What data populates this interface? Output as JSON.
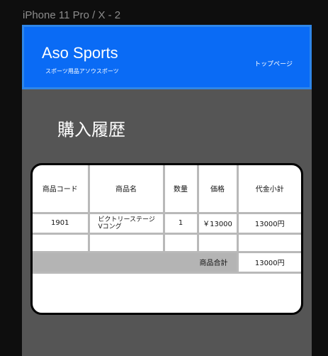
{
  "artboard": {
    "title": "iPhone 11 Pro / X - 2"
  },
  "header": {
    "brand": "Aso Sports",
    "tagline": "スポーツ用品アソウスポーツ",
    "top_link": "トップページ"
  },
  "page": {
    "title": "購入履歴"
  },
  "table": {
    "headers": {
      "code": "商品コード",
      "name": "商品名",
      "qty": "数量",
      "price": "価格",
      "subtotal": "代金小計"
    },
    "rows": [
      {
        "code": "1901",
        "name": "ビクトリーステージ\nVコング",
        "qty": "1",
        "price": "￥13000",
        "subtotal": "13000円"
      }
    ],
    "total_label": "商品合計",
    "total_value": "13000円"
  }
}
